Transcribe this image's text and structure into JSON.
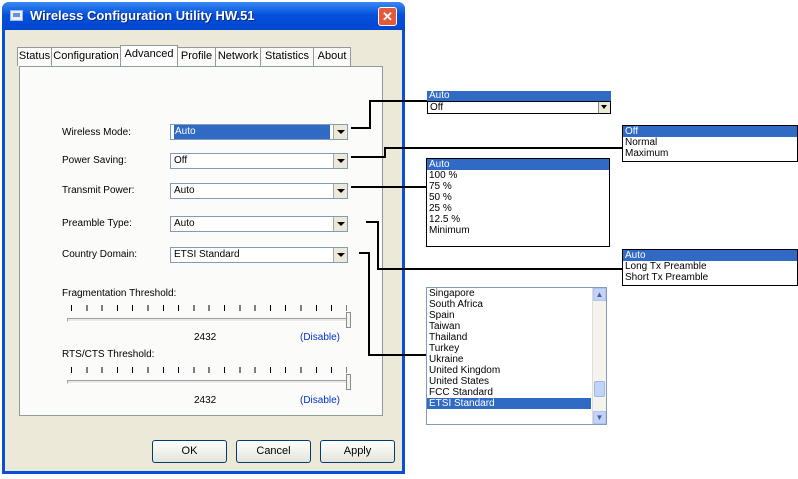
{
  "window": {
    "title": "Wireless Configuration Utility HW.51",
    "close_glyph": "✕"
  },
  "tabs": [
    {
      "label": "Status"
    },
    {
      "label": "Configuration"
    },
    {
      "label": "Advanced"
    },
    {
      "label": "Profile"
    },
    {
      "label": "Network"
    },
    {
      "label": "Statistics"
    },
    {
      "label": "About"
    }
  ],
  "active_tab": "Advanced",
  "fields": {
    "wireless_mode": {
      "label": "Wireless Mode:",
      "value": "Auto"
    },
    "power_saving": {
      "label": "Power Saving:",
      "value": "Off"
    },
    "transmit_power": {
      "label": "Transmit Power:",
      "value": "Auto"
    },
    "preamble_type": {
      "label": "Preamble Type:",
      "value": "Auto"
    },
    "country_domain": {
      "label": "Country Domain:",
      "value": "ETSI Standard"
    }
  },
  "fragmentation": {
    "label": "Fragmentation Threshold:",
    "value": "2432",
    "status": "(Disable)",
    "level": 1.0
  },
  "rts_cts": {
    "label": "RTS/CTS Threshold:",
    "value": "2432",
    "status": "(Disable)",
    "level": 1.0
  },
  "buttons": {
    "ok": "OK",
    "cancel": "Cancel",
    "apply": "Apply"
  },
  "callouts": {
    "wireless_mode_options": {
      "highlighted": "Auto",
      "combo_value": "Off"
    },
    "power_saving_options": [
      "Off",
      "Normal",
      "Maximum"
    ],
    "transmit_power_options": [
      "Auto",
      "100 %",
      "75 %",
      "50 %",
      "25 %",
      "12.5 %",
      "Minimum"
    ],
    "preamble_options": [
      "Auto",
      "Long Tx Preamble",
      "Short Tx Preamble"
    ],
    "country_options": [
      "Singapore",
      "South Africa",
      "Spain",
      "Taiwan",
      "Thailand",
      "Turkey",
      "Ukraine",
      "United Kingdom",
      "United States",
      "FCC Standard",
      "ETSI Standard"
    ]
  },
  "colors": {
    "selection": "#316ac5",
    "titlebar": "#0551dc",
    "link": "#0033cc"
  }
}
